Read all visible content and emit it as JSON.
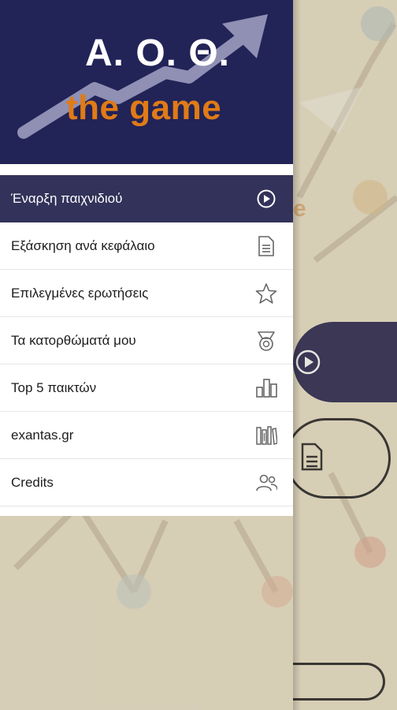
{
  "logo": {
    "title": "Α. Ο. Θ.",
    "subtitle": "the game"
  },
  "menu": {
    "items": [
      {
        "label": "Έναρξη παιχνιδιού",
        "icon": "play-circle-icon",
        "active": true
      },
      {
        "label": "Εξάσκηση ανά κεφάλαιο",
        "icon": "document-icon",
        "active": false
      },
      {
        "label": "Επιλεγμένες ερωτήσεις",
        "icon": "star-icon",
        "active": false
      },
      {
        "label": "Τα κατορθώματά μου",
        "icon": "medal-icon",
        "active": false
      },
      {
        "label": "Top 5 παικτών",
        "icon": "bar-chart-icon",
        "active": false
      },
      {
        "label": "exantas.gr",
        "icon": "library-icon",
        "active": false
      },
      {
        "label": "Credits",
        "icon": "users-icon",
        "active": false
      }
    ]
  },
  "colors": {
    "header_bg": "#222357",
    "active_bg": "#33325a",
    "logo_orange": "#e07b16",
    "background": "#ece3cb"
  }
}
